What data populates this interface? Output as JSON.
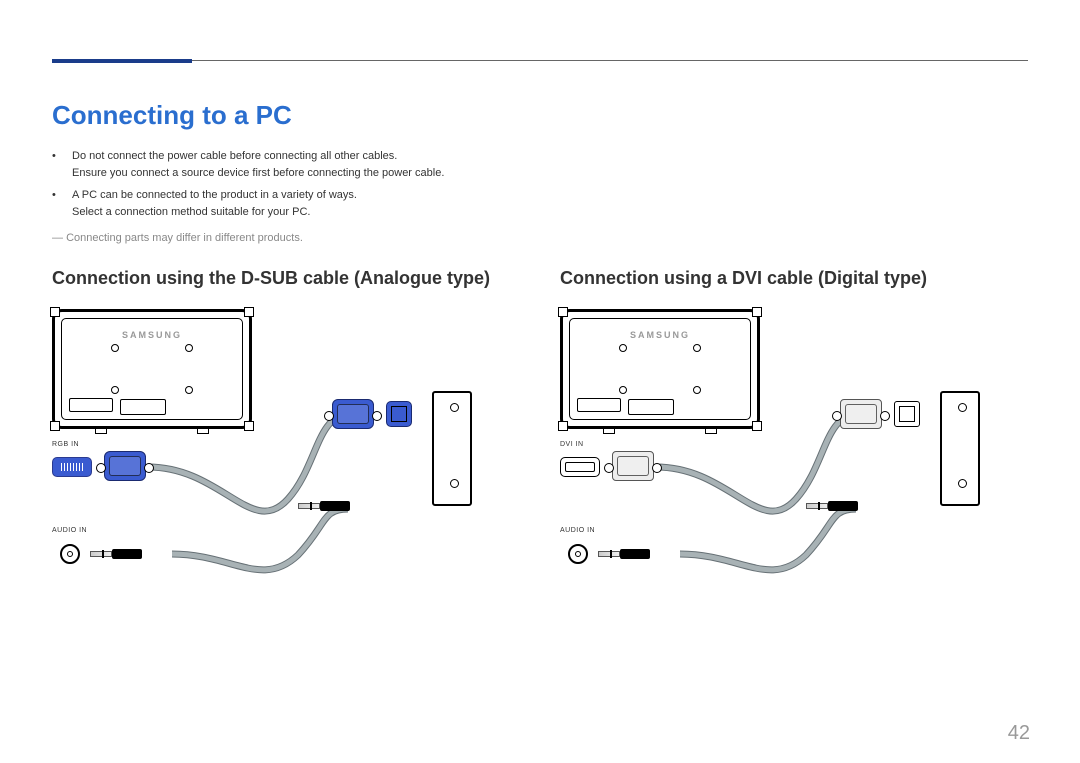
{
  "page": {
    "title": "Connecting to a PC",
    "number": "42"
  },
  "notes": {
    "item1_line1": "Do not connect the power cable before connecting all other cables.",
    "item1_line2": "Ensure you connect a source device first before connecting the power cable.",
    "item2_line1": "A PC can be connected to the product in a variety of ways.",
    "item2_line2": "Select a connection method suitable for your PC."
  },
  "footnote": "Connecting parts may differ in different products.",
  "sections": {
    "left": "Connection using the D-SUB cable (Analogue type)",
    "right": "Connection using a DVI cable (Digital type)"
  },
  "brand": "SAMSUNG",
  "labels": {
    "rgb_in": "RGB IN",
    "dvi_in": "DVI IN",
    "audio_in": "AUDIO IN"
  }
}
